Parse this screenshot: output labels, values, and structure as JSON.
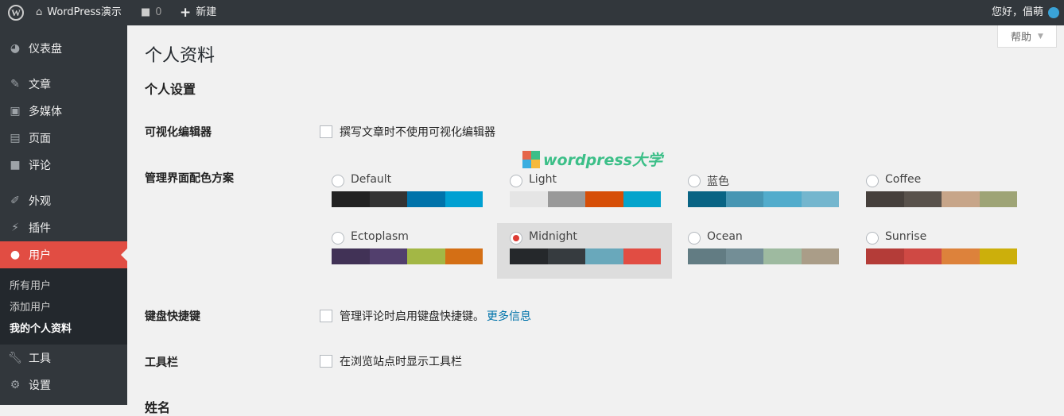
{
  "topbar": {
    "site": "WordPress演示",
    "comments": "0",
    "new": "新建",
    "greeting": "您好，倡萌"
  },
  "sidebar": {
    "items": [
      {
        "label": "仪表盘",
        "icon": "dashboard-icon"
      },
      {
        "label": "文章",
        "icon": "pin-icon"
      },
      {
        "label": "多媒体",
        "icon": "media-icon"
      },
      {
        "label": "页面",
        "icon": "page-icon"
      },
      {
        "label": "评论",
        "icon": "comment-icon"
      },
      {
        "label": "外观",
        "icon": "appearance-icon"
      },
      {
        "label": "插件",
        "icon": "plugin-icon"
      },
      {
        "label": "用户",
        "icon": "user-icon"
      },
      {
        "label": "工具",
        "icon": "wrench-icon"
      },
      {
        "label": "设置",
        "icon": "settings-icon"
      }
    ],
    "submenu": [
      "所有用户",
      "添加用户",
      "我的个人资料"
    ]
  },
  "help": "帮助",
  "page": {
    "title": "个人资料",
    "section": "个人设置",
    "visual_editor": {
      "label": "可视化编辑器",
      "option": "撰写文章时不使用可视化编辑器",
      "checked": false
    },
    "color_scheme": {
      "label": "管理界面配色方案",
      "selected": "Midnight",
      "schemes": [
        {
          "name": "Default",
          "colors": [
            "#222222",
            "#333333",
            "#0073aa",
            "#00a0d2"
          ]
        },
        {
          "name": "Light",
          "colors": [
            "#e5e5e5",
            "#999999",
            "#d64e07",
            "#04a4cc"
          ]
        },
        {
          "name": "蓝色",
          "colors": [
            "#096484",
            "#4796b3",
            "#52accc",
            "#74b6ce"
          ]
        },
        {
          "name": "Coffee",
          "colors": [
            "#46403c",
            "#59524c",
            "#c7a589",
            "#9ea476"
          ]
        },
        {
          "name": "Ectoplasm",
          "colors": [
            "#413256",
            "#523f6d",
            "#a3b745",
            "#d46f15"
          ]
        },
        {
          "name": "Midnight",
          "colors": [
            "#25282b",
            "#363b3f",
            "#69a8bb",
            "#e14d43"
          ]
        },
        {
          "name": "Ocean",
          "colors": [
            "#627c83",
            "#738e96",
            "#9ebaa0",
            "#aa9d88"
          ]
        },
        {
          "name": "Sunrise",
          "colors": [
            "#b43c38",
            "#cf4944",
            "#dd823b",
            "#ccaf0b"
          ]
        }
      ]
    },
    "shortcuts": {
      "label": "键盘快捷键",
      "option": "管理评论时启用键盘快捷键。",
      "link": "更多信息",
      "checked": false
    },
    "toolbar": {
      "label": "工具栏",
      "option": "在浏览站点时显示工具栏",
      "checked": false
    },
    "name_label": "姓名"
  },
  "watermark": "wordpress大学"
}
